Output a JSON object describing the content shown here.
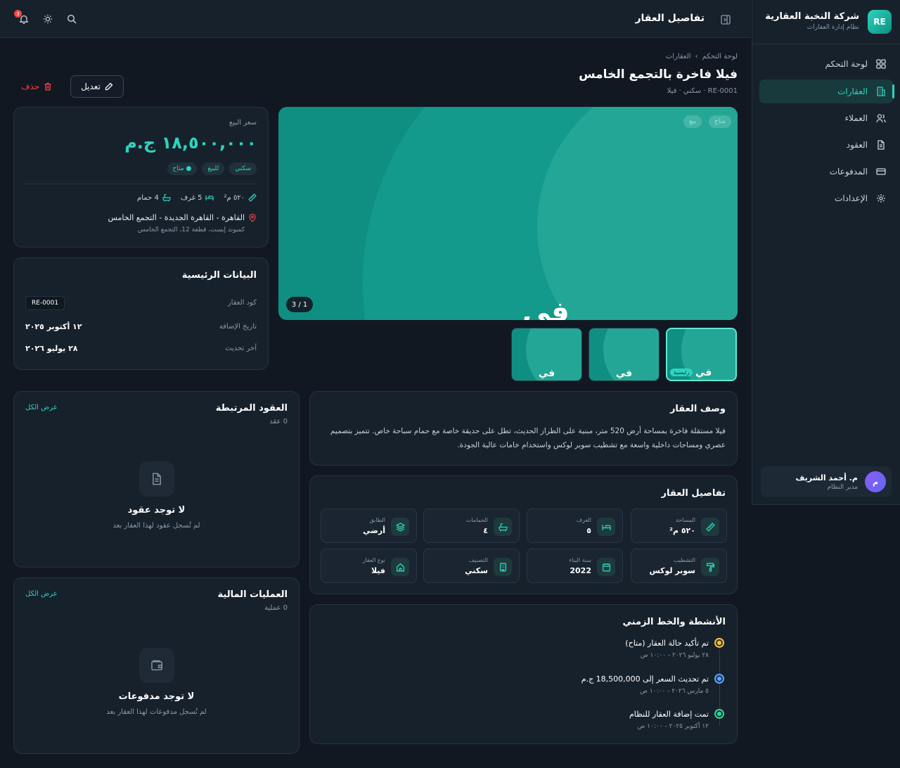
{
  "brand": {
    "logo": "RE",
    "name": "شركة النخبة العقارية",
    "subtitle": "نظام إدارة العقارات"
  },
  "sidebar": {
    "items": [
      {
        "label": "لوحة التحكم",
        "icon": "dashboard-icon",
        "active": false
      },
      {
        "label": "العقارات",
        "icon": "building-icon",
        "active": true
      },
      {
        "label": "العملاء",
        "icon": "users-icon",
        "active": false
      },
      {
        "label": "العقود",
        "icon": "document-icon",
        "active": false
      },
      {
        "label": "المدفوعات",
        "icon": "credit-card-icon",
        "active": false
      },
      {
        "label": "الإعدادات",
        "icon": "gear-icon",
        "active": false
      }
    ]
  },
  "user": {
    "initial": "م",
    "name": "م. أحمد الشريف",
    "role": "مدير النظام"
  },
  "header": {
    "title": "تفاصيل العقار",
    "notification_count": "3"
  },
  "breadcrumb": {
    "home": "لوحة التحكم",
    "current": "العقارات",
    "separator": "›"
  },
  "property": {
    "title": "فيلا فاخرة بالتجمع الخامس",
    "subtitle": "RE-0001 · سكني · فيلا"
  },
  "actions": {
    "edit": "تعديل",
    "delete": "حذف"
  },
  "gallery": {
    "badge_status": "متاح",
    "badge_type": "بيع",
    "counter": "1 / 3",
    "main_glyph": "في",
    "thumb_glyph": "في",
    "main_label": "رئيسية"
  },
  "price_card": {
    "label": "سعر البيع",
    "price": "١٨,٥٠٠,٠٠٠ ج.م",
    "tags": [
      "سكني",
      "للبيع",
      "● متاح"
    ],
    "area": "٥٢٠ م²",
    "rooms": "5 غرف",
    "baths": "4 حمام",
    "location": "القاهرة - القاهرة الجديدة - التجمع الخامس",
    "address": "كمبوند إيست، قطعة 12، التجمع الخامس"
  },
  "main_info": {
    "title": "البيانات الرئيسية",
    "rows": [
      {
        "label": "كود العقار",
        "value": "RE-0001"
      },
      {
        "label": "تاريخ الإضافة",
        "value": "١٢ أكتوبر ٢٠٢٥"
      },
      {
        "label": "آخر تحديث",
        "value": "٢٨ يوليو ٢٠٢٦"
      }
    ]
  },
  "description": {
    "title": "وصف العقار",
    "text": "فيلا مستقلة فاخرة بمساحة أرض 520 متر، مبنية على الطراز الحديث، تطل على حديقة خاصة مع حمام سباحة خاص. تتميز بتصميم عصري ومساحات داخلية واسعة مع تشطيب سوبر لوكس واستخدام خامات عالية الجودة."
  },
  "details": {
    "title": "تفاصيل العقار",
    "tiles": [
      {
        "label": "المساحة",
        "value": "٥٢٠ م²",
        "icon": "ruler-icon"
      },
      {
        "label": "الغرف",
        "value": "٥",
        "icon": "bed-icon"
      },
      {
        "label": "الحمامات",
        "value": "٤",
        "icon": "bath-icon"
      },
      {
        "label": "الطابق",
        "value": "أرضي",
        "icon": "layers-icon"
      },
      {
        "label": "التشطيب",
        "value": "سوبر لوكس",
        "icon": "paint-roller-icon"
      },
      {
        "label": "سنة البناء",
        "value": "2022",
        "icon": "calendar-icon"
      },
      {
        "label": "التصنيف",
        "value": "سكني",
        "icon": "building-icon"
      },
      {
        "label": "نوع العقار",
        "value": "فيلا",
        "icon": "home-icon"
      }
    ]
  },
  "contracts": {
    "title": "العقود المرتبطة",
    "count": "0 عقد",
    "view_all": "عرض الكل",
    "empty_title": "لا توجد عقود",
    "empty_sub": "لم تُسجل عقود لهذا العقار بعد"
  },
  "payments": {
    "title": "العمليات المالية",
    "count": "0 عملية",
    "view_all": "عرض الكل",
    "empty_title": "لا توجد مدفوعات",
    "empty_sub": "لم تُسجل مدفوعات لهذا العقار بعد"
  },
  "timeline": {
    "title": "الأنشطة والخط الزمني",
    "events": [
      {
        "title": "تم تأكيد حالة العقار (متاح)",
        "time": "٢٨ يوليو ٢٠٢٦ - ١٠:٠٠ ص",
        "color": "#f5c04a"
      },
      {
        "title": "تم تحديث السعر إلى 18,500,000 ج.م",
        "time": "٥ مارس ٢٠٢٦ - ١٠:٠٠ ص",
        "color": "#60a5fa"
      },
      {
        "title": "تمت إضافة العقار للنظام",
        "time": "١٢ أكتوبر ٢٠٢٥ - ١٠:٠٠ ص",
        "color": "#34d399"
      }
    ]
  },
  "colors": {
    "accent": "#2dd4bf",
    "background": "#111821",
    "card": "#17212c",
    "danger": "#ef4444"
  }
}
